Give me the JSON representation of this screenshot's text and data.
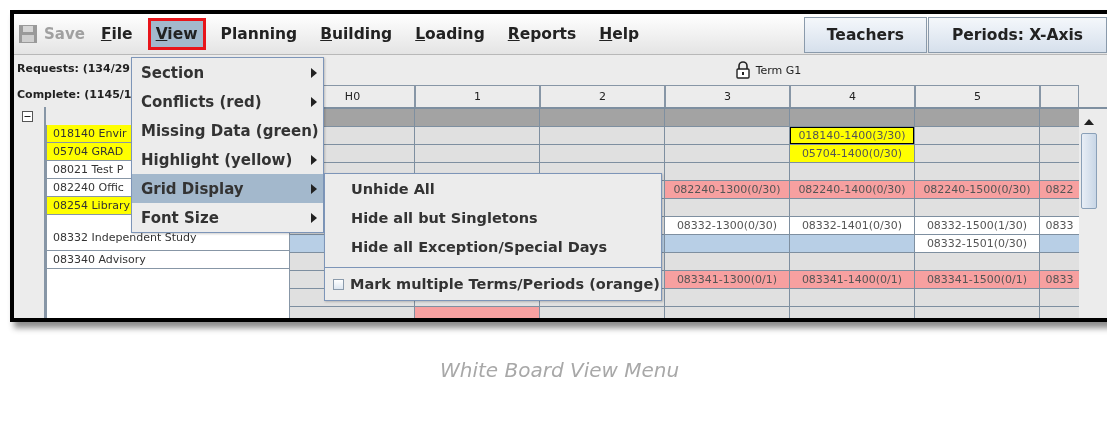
{
  "toolbar": {
    "save": {
      "label": "Save",
      "disabled": true
    },
    "menus": [
      {
        "label": "File",
        "mnemonic": true,
        "selected": false,
        "annotated": false
      },
      {
        "label": "View",
        "mnemonic": true,
        "selected": true,
        "annotated": true
      },
      {
        "label": "Planning",
        "mnemonic": false,
        "selected": false,
        "annotated": false
      },
      {
        "label": "Building",
        "mnemonic": true,
        "selected": false,
        "annotated": false
      },
      {
        "label": "Loading",
        "mnemonic": true,
        "selected": false,
        "annotated": false
      },
      {
        "label": "Reports",
        "mnemonic": true,
        "selected": false,
        "annotated": false
      },
      {
        "label": "Help",
        "mnemonic": true,
        "selected": false,
        "annotated": false
      }
    ],
    "buttons": [
      "Teachers",
      "Periods: X-Axis"
    ]
  },
  "sidebar": {
    "requests": "Requests: (134/29",
    "complete": "Complete: (1145/1",
    "expanded": true,
    "items": [
      {
        "label": "018140 Envir",
        "color": "#ffff00",
        "kind": "single"
      },
      {
        "label": "05704 GRAD",
        "color": "#ffff00",
        "kind": "single"
      },
      {
        "label": "08021 Test P",
        "color": "#ffffff",
        "kind": "single"
      },
      {
        "label": "082240 Offic",
        "color": "#ffffff",
        "kind": "single"
      },
      {
        "label": "08254 Library",
        "color": "#ffff00",
        "kind": "single"
      },
      {
        "label": "08332 Independent Study",
        "color": "#ffffff",
        "kind": "double"
      },
      {
        "label": "083340 Advisory",
        "color": "#ffffff",
        "kind": "single"
      },
      {
        "color": "#ffffff",
        "kind": "triple"
      }
    ]
  },
  "grid": {
    "term": "Term G1",
    "locked": true,
    "columns": [
      "H0",
      "1",
      "2",
      "3",
      "4",
      "5"
    ],
    "rows": [
      {
        "kind": "dark",
        "cells": [
          null,
          null,
          null,
          null,
          null,
          null,
          null
        ]
      },
      {
        "kind": "plain",
        "cells": [
          null,
          null,
          null,
          null,
          {
            "text": "018140-1400(3/30)",
            "color": "#ffff00"
          },
          null,
          null
        ]
      },
      {
        "kind": "plain",
        "cells": [
          null,
          null,
          null,
          null,
          {
            "text": "05704-1400(0/30)",
            "color": "#ffff00"
          },
          null,
          null
        ]
      },
      {
        "kind": "plain",
        "cells": [
          null,
          null,
          null,
          null,
          null,
          null,
          null
        ]
      },
      {
        "kind": "plain",
        "cells": [
          null,
          null,
          null,
          {
            "text": "082240-1300(0/30)",
            "color": "#f7a0a0"
          },
          {
            "text": "082240-1400(0/30)",
            "color": "#f7a0a0"
          },
          {
            "text": "082240-1500(0/30)",
            "color": "#f7a0a0"
          },
          {
            "text": "0822",
            "color": "#f7a0a0"
          }
        ]
      },
      {
        "kind": "plain",
        "cells": [
          null,
          null,
          null,
          null,
          null,
          null,
          null
        ]
      },
      {
        "kind": "plain",
        "cells": [
          null,
          null,
          null,
          {
            "text": "08332-1300(0/30)",
            "color": "#ffffff"
          },
          {
            "text": "08332-1401(0/30)",
            "color": "#ffffff"
          },
          {
            "text": "08332-1500(1/30)",
            "color": "#ffffff"
          },
          {
            "text": "0833",
            "color": "#ffffff"
          }
        ]
      },
      {
        "kind": "blue",
        "cells": [
          null,
          null,
          null,
          null,
          null,
          {
            "text": "08332-1501(0/30)",
            "color": "#ffffff"
          },
          null
        ]
      },
      {
        "kind": "plain",
        "cells": [
          null,
          null,
          null,
          null,
          null,
          null,
          null
        ]
      },
      {
        "kind": "plain",
        "cells": [
          null,
          null,
          null,
          {
            "text": "083341-1300(0/1)",
            "color": "#f7a0a0"
          },
          {
            "text": "083341-1400(0/1)",
            "color": "#f7a0a0"
          },
          {
            "text": "083341-1500(0/1)",
            "color": "#f7a0a0"
          },
          {
            "text": "0833",
            "color": "#f7a0a0"
          }
        ]
      },
      {
        "kind": "plain",
        "cells": [
          null,
          null,
          null,
          null,
          null,
          null,
          null
        ]
      },
      {
        "kind": "plain",
        "cells": [
          null,
          {
            "color": "#f7a0a0"
          },
          null,
          null,
          null,
          null,
          null
        ]
      }
    ]
  },
  "menu": {
    "items": [
      {
        "label": "Section",
        "selected": false
      },
      {
        "label": "Conflicts (red)",
        "selected": false
      },
      {
        "label": "Missing Data (green)",
        "selected": false
      },
      {
        "label": "Highlight (yellow)",
        "selected": false
      },
      {
        "label": "Grid Display",
        "selected": true
      },
      {
        "label": "Font Size",
        "selected": false
      }
    ]
  },
  "submenu": {
    "items": [
      {
        "kind": "action",
        "label": "Unhide All"
      },
      {
        "kind": "action",
        "label": "Hide all but Singletons"
      },
      {
        "kind": "action",
        "label": "Hide all Exception/Special Days"
      },
      {
        "kind": "separator"
      },
      {
        "kind": "checkbox",
        "label": "Mark multiple Terms/Periods (orange)",
        "checked": false
      }
    ]
  },
  "caption": "White Board View Menu"
}
